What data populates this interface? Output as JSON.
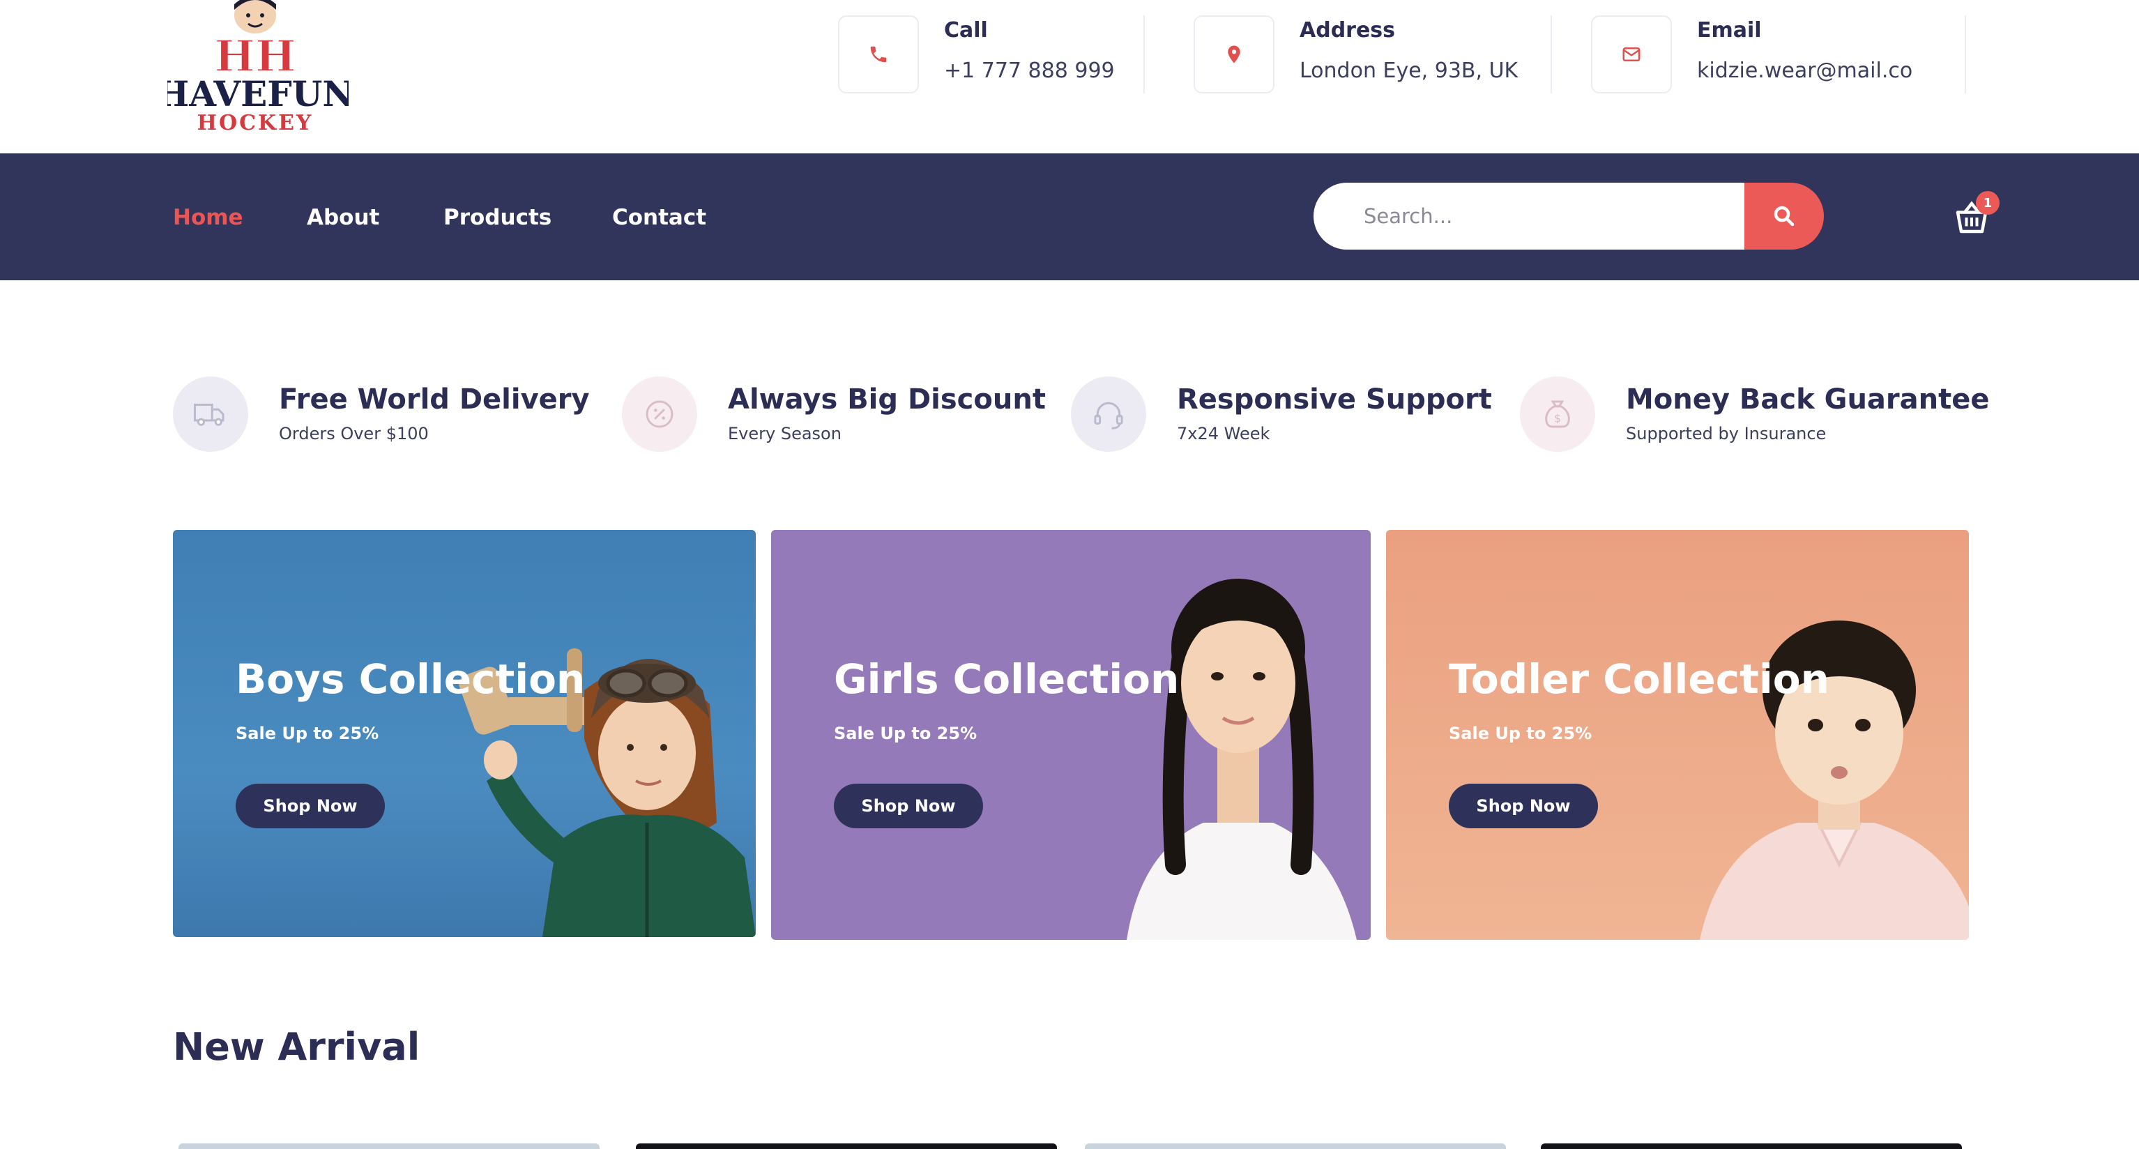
{
  "brand": {
    "logo_line1": "HAVEFUN",
    "logo_line2": "HOCKEY",
    "logo_monogram": "HH"
  },
  "contacts": [
    {
      "icon": "phone-icon",
      "title": "Call",
      "value": "+1 777 888 999"
    },
    {
      "icon": "map-pin-icon",
      "title": "Address",
      "value": "London Eye, 93B, UK"
    },
    {
      "icon": "envelope-icon",
      "title": "Email",
      "value": "kidzie.wear@mail.co"
    }
  ],
  "nav": {
    "items": [
      {
        "label": "Home",
        "active": true
      },
      {
        "label": "About",
        "active": false
      },
      {
        "label": "Products",
        "active": false
      },
      {
        "label": "Contact",
        "active": false
      }
    ],
    "search_placeholder": "Search...",
    "cart_count": "1"
  },
  "features": [
    {
      "icon": "delivery-truck-icon",
      "title": "Free World Delivery",
      "subtitle": "Orders Over $100"
    },
    {
      "icon": "discount-percent-icon",
      "title": "Always Big Discount",
      "subtitle": "Every Season"
    },
    {
      "icon": "headset-icon",
      "title": "Responsive Support",
      "subtitle": "7x24 Week"
    },
    {
      "icon": "money-bag-icon",
      "title": "Money Back Guarantee",
      "subtitle": "Supported by Insurance"
    }
  ],
  "banners": [
    {
      "title": "Boys Collection",
      "subtitle": "Sale Up to 25%",
      "button": "Shop Now",
      "bg": "#4a86b8"
    },
    {
      "title": "Girls Collection",
      "subtitle": "Sale Up to 25%",
      "button": "Shop Now",
      "bg": "#957ab9"
    },
    {
      "title": "Todler Collection",
      "subtitle": "Sale Up to 25%",
      "button": "Shop Now",
      "bg": "#eba682"
    }
  ],
  "new_arrival": {
    "title": "New Arrival"
  },
  "colors": {
    "navy": "#31355b",
    "accent": "#e85656",
    "text": "#2b2d55"
  }
}
